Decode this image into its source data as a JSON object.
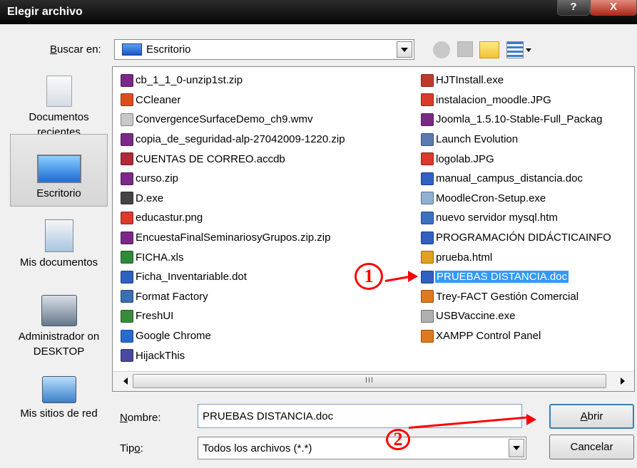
{
  "window": {
    "title": "Elegir archivo",
    "help_label": "?",
    "close_label": "X"
  },
  "lookin": {
    "label_prefix": "",
    "label_accel": "B",
    "label_rest": "uscar en:",
    "value": "Escritorio"
  },
  "places": [
    {
      "label": "Documentos recientes",
      "icon": "recent-documents-icon",
      "selected": false
    },
    {
      "label": "Escritorio",
      "icon": "desktop-icon",
      "selected": true
    },
    {
      "label": "Mis documentos",
      "icon": "my-documents-icon",
      "selected": false
    },
    {
      "label": "Administrador on DESKTOP",
      "icon": "computer-icon",
      "selected": false
    },
    {
      "label": "Mis sitios de red",
      "icon": "network-icon",
      "selected": false
    }
  ],
  "files_col1": [
    {
      "name": "cb_1_1_0-unzip1st.zip",
      "icon": "winrar-icon",
      "color": "#7a2a86"
    },
    {
      "name": "CCleaner",
      "icon": "ccleaner-icon",
      "color": "#d9501e"
    },
    {
      "name": "ConvergenceSurfaceDemo_ch9.wmv",
      "icon": "video-icon",
      "color": "#c8c8c8"
    },
    {
      "name": "copia_de_seguridad-alp-27042009-1220.zip",
      "icon": "winrar-icon",
      "color": "#7a2a86"
    },
    {
      "name": "CUENTAS DE CORREO.accdb",
      "icon": "access-icon",
      "color": "#b02a3a"
    },
    {
      "name": "curso.zip",
      "icon": "winrar-icon",
      "color": "#7a2a86"
    },
    {
      "name": "D.exe",
      "icon": "tools-icon",
      "color": "#444444"
    },
    {
      "name": "educastur.png",
      "icon": "image-icon",
      "color": "#d93a2b"
    },
    {
      "name": "EncuestaFinalSeminariosyGrupos.zip.zip",
      "icon": "winrar-icon",
      "color": "#7a2a86"
    },
    {
      "name": "FICHA.xls",
      "icon": "excel-icon",
      "color": "#2f8a3a"
    },
    {
      "name": "Ficha_Inventariable.dot",
      "icon": "word-icon",
      "color": "#3060c0"
    },
    {
      "name": "Format Factory",
      "icon": "shortcut-icon",
      "color": "#3a6fb0"
    },
    {
      "name": "FreshUI",
      "icon": "shortcut-icon",
      "color": "#3a8a3a"
    },
    {
      "name": "Google Chrome",
      "icon": "shortcut-icon",
      "color": "#2a6ad0"
    },
    {
      "name": "HijackThis",
      "icon": "shortcut-icon",
      "color": "#4a4aa0"
    }
  ],
  "files_col2": [
    {
      "name": "HJTInstall.exe",
      "icon": "installer-icon",
      "color": "#c03a2a",
      "selected": false
    },
    {
      "name": "instalacion_moodle.JPG",
      "icon": "image-icon",
      "color": "#d93a2b",
      "selected": false
    },
    {
      "name": "Joomla_1.5.10-Stable-Full_Packag",
      "icon": "winrar-icon",
      "color": "#7a2a86",
      "selected": false
    },
    {
      "name": "Launch Evolution",
      "icon": "shortcut-icon",
      "color": "#5a7ab0",
      "selected": false
    },
    {
      "name": "logolab.JPG",
      "icon": "image-icon",
      "color": "#d93a2b",
      "selected": false
    },
    {
      "name": "manual_campus_distancia.doc",
      "icon": "word-icon",
      "color": "#3060c0",
      "selected": false
    },
    {
      "name": "MoodleCron-Setup.exe",
      "icon": "setup-icon",
      "color": "#8fb0d0",
      "selected": false
    },
    {
      "name": "nuevo servidor mysql.htm",
      "icon": "web-document-icon",
      "color": "#3a70c0",
      "selected": false
    },
    {
      "name": "PROGRAMACIÓN DIDÁCTICAINFO",
      "icon": "word-icon",
      "color": "#3060c0",
      "selected": false
    },
    {
      "name": "prueba.html",
      "icon": "chrome-icon",
      "color": "#e0a020",
      "selected": false
    },
    {
      "name": "PRUEBAS DISTANCIA.doc",
      "icon": "word-icon",
      "color": "#3060c0",
      "selected": true
    },
    {
      "name": "Trey-FACT Gestión Comercial",
      "icon": "shortcut-icon",
      "color": "#e07a20",
      "selected": false
    },
    {
      "name": "USBVaccine.exe",
      "icon": "syringe-icon",
      "color": "#b0b0b0",
      "selected": false
    },
    {
      "name": "XAMPP Control Panel",
      "icon": "shortcut-icon",
      "color": "#e07a20",
      "selected": false
    }
  ],
  "scrollbar": {
    "thumb_grip": "III"
  },
  "name_field": {
    "label_accel": "N",
    "label_rest": "ombre:",
    "value": "PRUEBAS DISTANCIA.doc"
  },
  "type_field": {
    "label_start": "Tip",
    "label_accel": "o",
    "label_rest": ":",
    "value": "Todos los archivos (*.*)"
  },
  "buttons": {
    "open_accel": "A",
    "open_rest": "brir",
    "cancel": "Cancelar"
  },
  "annotations": {
    "step1": "1",
    "step2": "2",
    "color": "#ff0000"
  }
}
